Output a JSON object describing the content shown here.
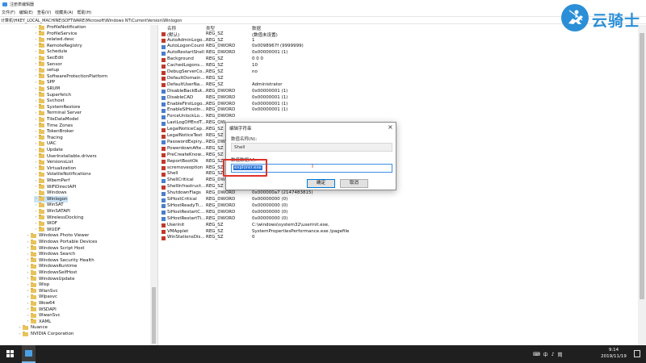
{
  "window": {
    "title": "注册表编辑器"
  },
  "menu": [
    "文件(F)",
    "编辑(E)",
    "查看(V)",
    "收藏夹(A)",
    "帮助(H)"
  ],
  "address": "计算机\\HKEY_LOCAL_MACHINE\\SOFTWARE\\Microsoft\\Windows NT\\CurrentVersion\\Winlogon",
  "tree": [
    {
      "label": "ProfileNotification",
      "indent": 1
    },
    {
      "label": "ProfileService",
      "indent": 1
    },
    {
      "label": "related.desc",
      "indent": 1
    },
    {
      "label": "RemoteRegistry",
      "indent": 1
    },
    {
      "label": "Schedule",
      "indent": 1
    },
    {
      "label": "SecEdit",
      "indent": 1
    },
    {
      "label": "Sensor",
      "indent": 1
    },
    {
      "label": "setup",
      "indent": 1
    },
    {
      "label": "SoftwareProtectionPlatform",
      "indent": 1
    },
    {
      "label": "SPP",
      "indent": 1
    },
    {
      "label": "SRUM",
      "indent": 1
    },
    {
      "label": "Superfetch",
      "indent": 1
    },
    {
      "label": "Svchost",
      "indent": 1
    },
    {
      "label": "SystemRestore",
      "indent": 1
    },
    {
      "label": "Terminal Server",
      "indent": 1
    },
    {
      "label": "TileDataModel",
      "indent": 1
    },
    {
      "label": "Time Zones",
      "indent": 1
    },
    {
      "label": "TokenBroker",
      "indent": 1
    },
    {
      "label": "Tracing",
      "indent": 1
    },
    {
      "label": "UAC",
      "indent": 1
    },
    {
      "label": "Update",
      "indent": 1
    },
    {
      "label": "UserInstallable.drivers",
      "indent": 1
    },
    {
      "label": "VersionsList",
      "indent": 1
    },
    {
      "label": "Virtualization",
      "indent": 1
    },
    {
      "label": "VolatileNotifications",
      "indent": 1
    },
    {
      "label": "WbemPerf",
      "indent": 1
    },
    {
      "label": "WiFiDirectAPI",
      "indent": 1
    },
    {
      "label": "Windows",
      "indent": 1
    },
    {
      "label": "Winlogon",
      "indent": 1,
      "selected": true
    },
    {
      "label": "WinSAT",
      "indent": 1
    },
    {
      "label": "WinSATAPI",
      "indent": 1
    },
    {
      "label": "WirelessDocking",
      "indent": 1
    },
    {
      "label": "WOF",
      "indent": 1
    },
    {
      "label": "WUDF",
      "indent": 1
    },
    {
      "label": "Windows Photo Viewer",
      "indent": 0
    },
    {
      "label": "Windows Portable Devices",
      "indent": 0
    },
    {
      "label": "Windows Script Host",
      "indent": 0
    },
    {
      "label": "Windows Search",
      "indent": 0
    },
    {
      "label": "Windows Security Health",
      "indent": 0
    },
    {
      "label": "WindowsRuntime",
      "indent": 0
    },
    {
      "label": "WindowsSelfHost",
      "indent": 0
    },
    {
      "label": "WindowsUpdate",
      "indent": 0
    },
    {
      "label": "Wisp",
      "indent": 0
    },
    {
      "label": "WlanSvc",
      "indent": 0
    },
    {
      "label": "Wlpasvc",
      "indent": 0
    },
    {
      "label": "Wow64",
      "indent": 0
    },
    {
      "label": "WSDAPI",
      "indent": 0
    },
    {
      "label": "WwanSvc",
      "indent": 0
    },
    {
      "label": "XAML",
      "indent": 0
    },
    {
      "label": "Nuance",
      "indent": -1
    },
    {
      "label": "NVIDIA Corporation",
      "indent": -1
    }
  ],
  "columns": {
    "name": "名称",
    "type": "类型",
    "data": "数据"
  },
  "values": [
    {
      "name": "(默认)",
      "type": "REG_SZ",
      "data": "(数值未设置)",
      "kind": "sz"
    },
    {
      "name": "AutoAdminLogo...",
      "type": "REG_SZ",
      "data": "1",
      "kind": "sz"
    },
    {
      "name": "AutoLogonCount",
      "type": "REG_DWORD",
      "data": "0x0098967f (9999999)",
      "kind": "dw"
    },
    {
      "name": "AutoRestartShell",
      "type": "REG_DWORD",
      "data": "0x00000001 (1)",
      "kind": "dw"
    },
    {
      "name": "Background",
      "type": "REG_SZ",
      "data": "0 0 0",
      "kind": "sz"
    },
    {
      "name": "CachedLogons...",
      "type": "REG_SZ",
      "data": "10",
      "kind": "sz"
    },
    {
      "name": "DebugServerCo...",
      "type": "REG_SZ",
      "data": "no",
      "kind": "sz"
    },
    {
      "name": "DefaultDomain...",
      "type": "REG_SZ",
      "data": "",
      "kind": "sz"
    },
    {
      "name": "DefaultUserNa...",
      "type": "REG_SZ",
      "data": "Administrator",
      "kind": "sz"
    },
    {
      "name": "DisableBackBut...",
      "type": "REG_DWORD",
      "data": "0x00000001 (1)",
      "kind": "dw"
    },
    {
      "name": "DisableCAD",
      "type": "REG_DWORD",
      "data": "0x00000001 (1)",
      "kind": "dw"
    },
    {
      "name": "EnableFirstLogo...",
      "type": "REG_DWORD",
      "data": "0x00000001 (1)",
      "kind": "dw"
    },
    {
      "name": "EnableSIHostIn...",
      "type": "REG_DWORD",
      "data": "0x00000001 (1)",
      "kind": "dw"
    },
    {
      "name": "ForceUnlockLo...",
      "type": "REG_DWORD",
      "data": "",
      "kind": "dw"
    },
    {
      "name": "LastLogOffEndT...",
      "type": "REG_QW",
      "data": "",
      "kind": "dw"
    },
    {
      "name": "LegalNoticeCap...",
      "type": "REG_SZ",
      "data": "",
      "kind": "sz"
    },
    {
      "name": "LegalNoticeText",
      "type": "REG_SZ",
      "data": "",
      "kind": "sz"
    },
    {
      "name": "PasswordExpiry...",
      "type": "REG_DW",
      "data": "",
      "kind": "dw"
    },
    {
      "name": "PowerdownAfte...",
      "type": "REG_SZ",
      "data": "",
      "kind": "sz"
    },
    {
      "name": "PreCreateKnow...",
      "type": "REG_SZ",
      "data": "",
      "kind": "sz"
    },
    {
      "name": "ReportBootOk",
      "type": "REG_SZ",
      "data": "",
      "kind": "sz"
    },
    {
      "name": "scremoveoption",
      "type": "REG_SZ",
      "data": "",
      "kind": "sz"
    },
    {
      "name": "Shell",
      "type": "REG_SZ",
      "data": "",
      "kind": "sz"
    },
    {
      "name": "ShellCritical",
      "type": "REG_DW",
      "data": "",
      "kind": "dw"
    },
    {
      "name": "ShellInfrastruct...",
      "type": "REG_SZ",
      "data": "",
      "kind": "sz"
    },
    {
      "name": "ShutdownFlags",
      "type": "REG_DWORD",
      "data": "0x000000a7 (2147483815)",
      "kind": "dw"
    },
    {
      "name": "SiHostCritical",
      "type": "REG_DWORD",
      "data": "0x00000000 (0)",
      "kind": "dw"
    },
    {
      "name": "SiHostReadyTi...",
      "type": "REG_DWORD",
      "data": "0x00000000 (0)",
      "kind": "dw"
    },
    {
      "name": "SiHostRestartC...",
      "type": "REG_DWORD",
      "data": "0x00000000 (0)",
      "kind": "dw"
    },
    {
      "name": "SiHostRestartTi...",
      "type": "REG_DWORD",
      "data": "0x00000000 (0)",
      "kind": "dw"
    },
    {
      "name": "Userinit",
      "type": "REG_SZ",
      "data": "C:\\windows\\system32\\userinit.exe,",
      "kind": "sz"
    },
    {
      "name": "VMApplet",
      "type": "REG_SZ",
      "data": "SystemPropertiesPerformance.exe /pagefile",
      "kind": "sz"
    },
    {
      "name": "WinStationsDis...",
      "type": "REG_SZ",
      "data": "0",
      "kind": "sz"
    }
  ],
  "logo": {
    "text": "云骑士"
  },
  "dialog": {
    "title": "编辑字符串",
    "name_label": "数值名称(N):",
    "name_value": "Shell",
    "data_label": "数值数据(V):",
    "data_value": "explorer.exe",
    "ok": "确定",
    "cancel": "取消"
  },
  "taskbar": {
    "tray_icons": [
      "⌨",
      "中",
      "♪",
      "简"
    ],
    "time": "9:14",
    "date": "2019/11/19"
  }
}
